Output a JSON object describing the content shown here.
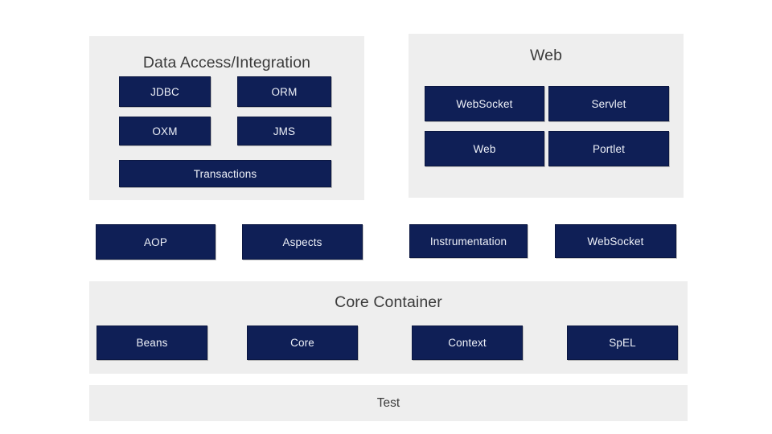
{
  "diagram": {
    "title_color": "#3b3b3b",
    "panel_color": "#eeeeee",
    "box_color": "#0f1f56",
    "box_text_color": "#eef1f8",
    "background_color": "#ffffff",
    "groups": [
      {
        "name": "data-access-integration",
        "title": "Data Access/Integration",
        "modules": [
          {
            "label": "JDBC"
          },
          {
            "label": "ORM"
          },
          {
            "label": "OXM"
          },
          {
            "label": "JMS"
          },
          {
            "label": "Transactions"
          }
        ]
      },
      {
        "name": "web",
        "title": "Web",
        "modules": [
          {
            "label": "WebSocket"
          },
          {
            "label": "Servlet"
          },
          {
            "label": "Web"
          },
          {
            "label": "Portlet"
          }
        ]
      },
      {
        "name": "core-container",
        "title": "Core Container",
        "modules": [
          {
            "label": "Beans"
          },
          {
            "label": "Core"
          },
          {
            "label": "Context"
          },
          {
            "label": "SpEL"
          }
        ]
      }
    ],
    "standalone_modules": [
      {
        "label": "AOP"
      },
      {
        "label": "Aspects"
      },
      {
        "label": "Instrumentation"
      },
      {
        "label": "WebSocket"
      }
    ],
    "bottom_bar": {
      "label": "Test"
    }
  }
}
